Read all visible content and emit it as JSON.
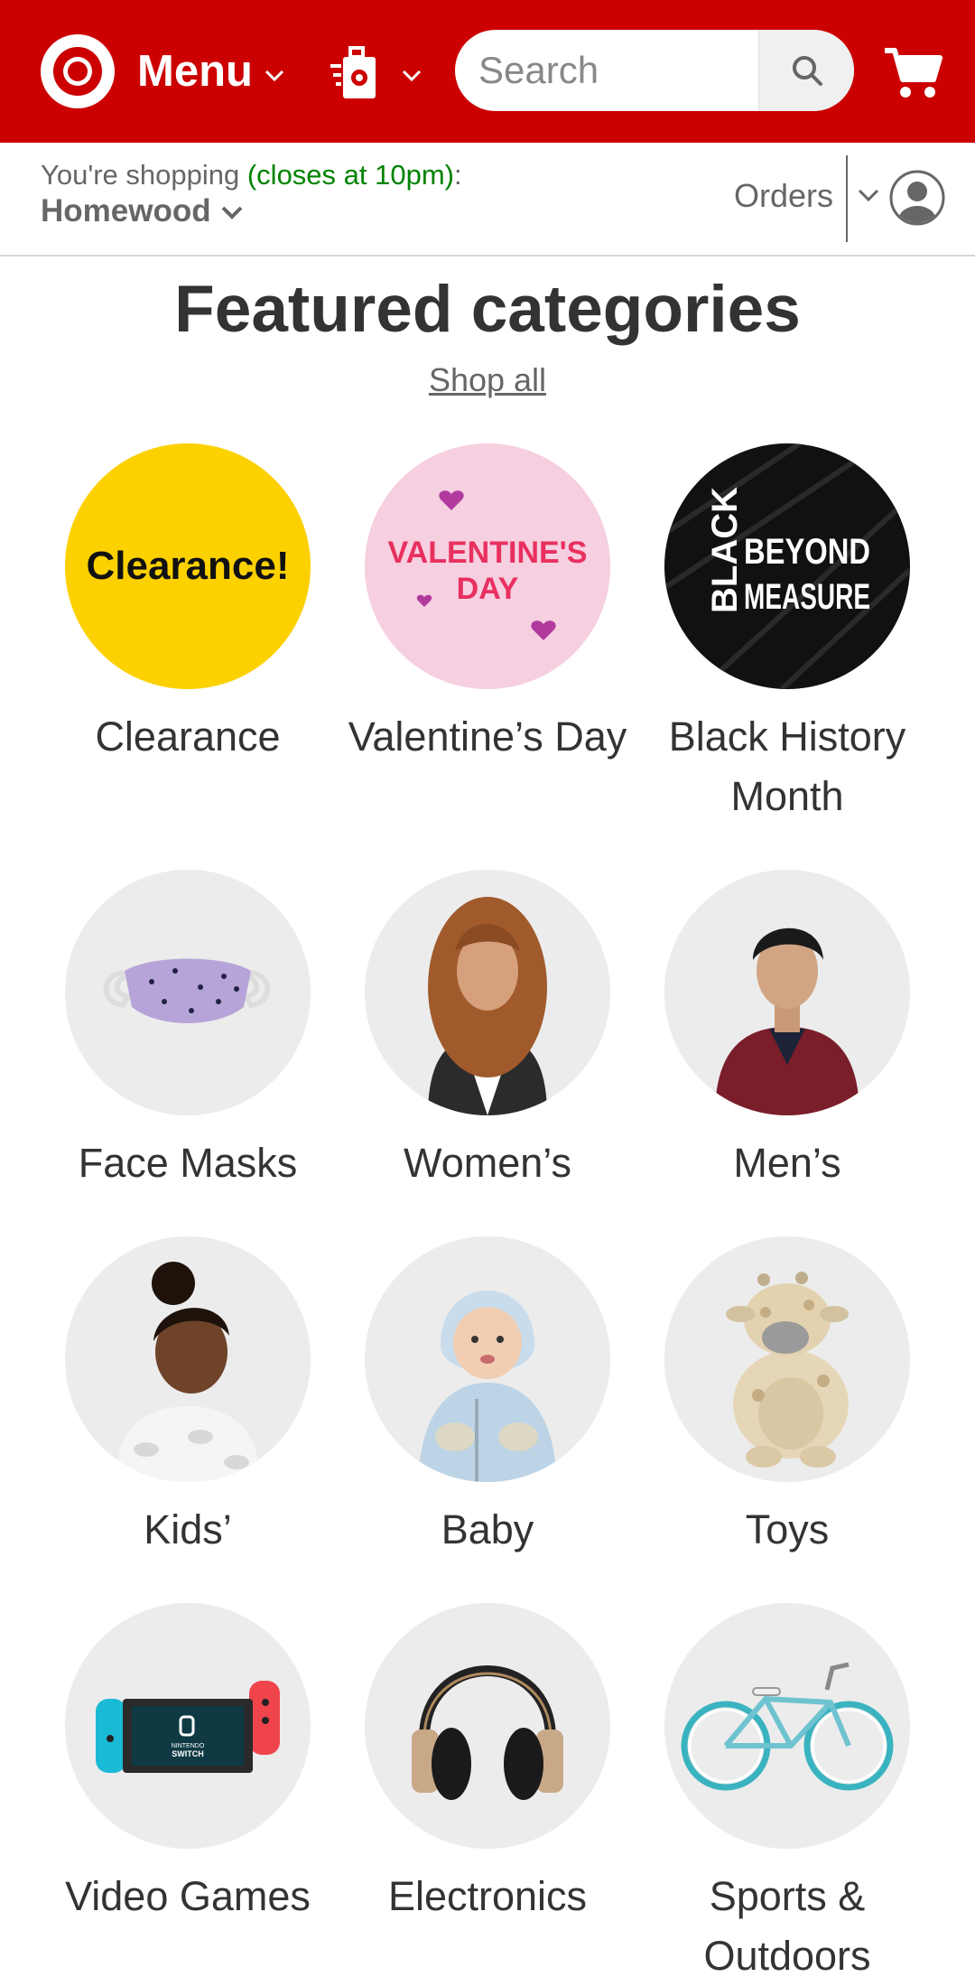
{
  "header": {
    "menu_label": "Menu",
    "search_placeholder": "Search",
    "icons": {
      "logo": "target-bullseye-logo",
      "pickup": "store-pickup-bag-icon",
      "search": "search-icon",
      "cart": "cart-icon",
      "chevron": "chevron-down-icon"
    }
  },
  "store_bar": {
    "prefix": "You're shopping ",
    "hours": "(closes at 10pm)",
    "suffix": ":",
    "store_name": "Homewood",
    "orders_label": "Orders",
    "avatar_icon": "account-avatar-icon"
  },
  "featured": {
    "title": "Featured categories",
    "shop_all": "Shop all",
    "categories": [
      {
        "label": "Clearance",
        "badge_text": "Clearance!"
      },
      {
        "label": "Valentine’s Day",
        "badge_line1": "VALENTINE'S",
        "badge_line2": "DAY"
      },
      {
        "label": "Black History Month",
        "badge_vertical": "BLACK",
        "badge_line1": "BEYOND",
        "badge_line2": "MEASURE"
      },
      {
        "label": "Face Masks"
      },
      {
        "label": "Women’s"
      },
      {
        "label": "Men’s"
      },
      {
        "label": "Kids’"
      },
      {
        "label": "Baby"
      },
      {
        "label": "Toys"
      },
      {
        "label": "Video Games",
        "badge_line1": "NINTENDO",
        "badge_line2": "SWITCH"
      },
      {
        "label": "Electronics"
      },
      {
        "label": "Sports & Outdoors"
      }
    ]
  },
  "colors": {
    "brand_red": "#cc0000",
    "open_green": "#008300",
    "text_dark": "#333333",
    "text_muted": "#666666",
    "clearance_yellow": "#fdd100",
    "valentine_pink": "#f6cfe0",
    "bhm_black": "#111111"
  }
}
